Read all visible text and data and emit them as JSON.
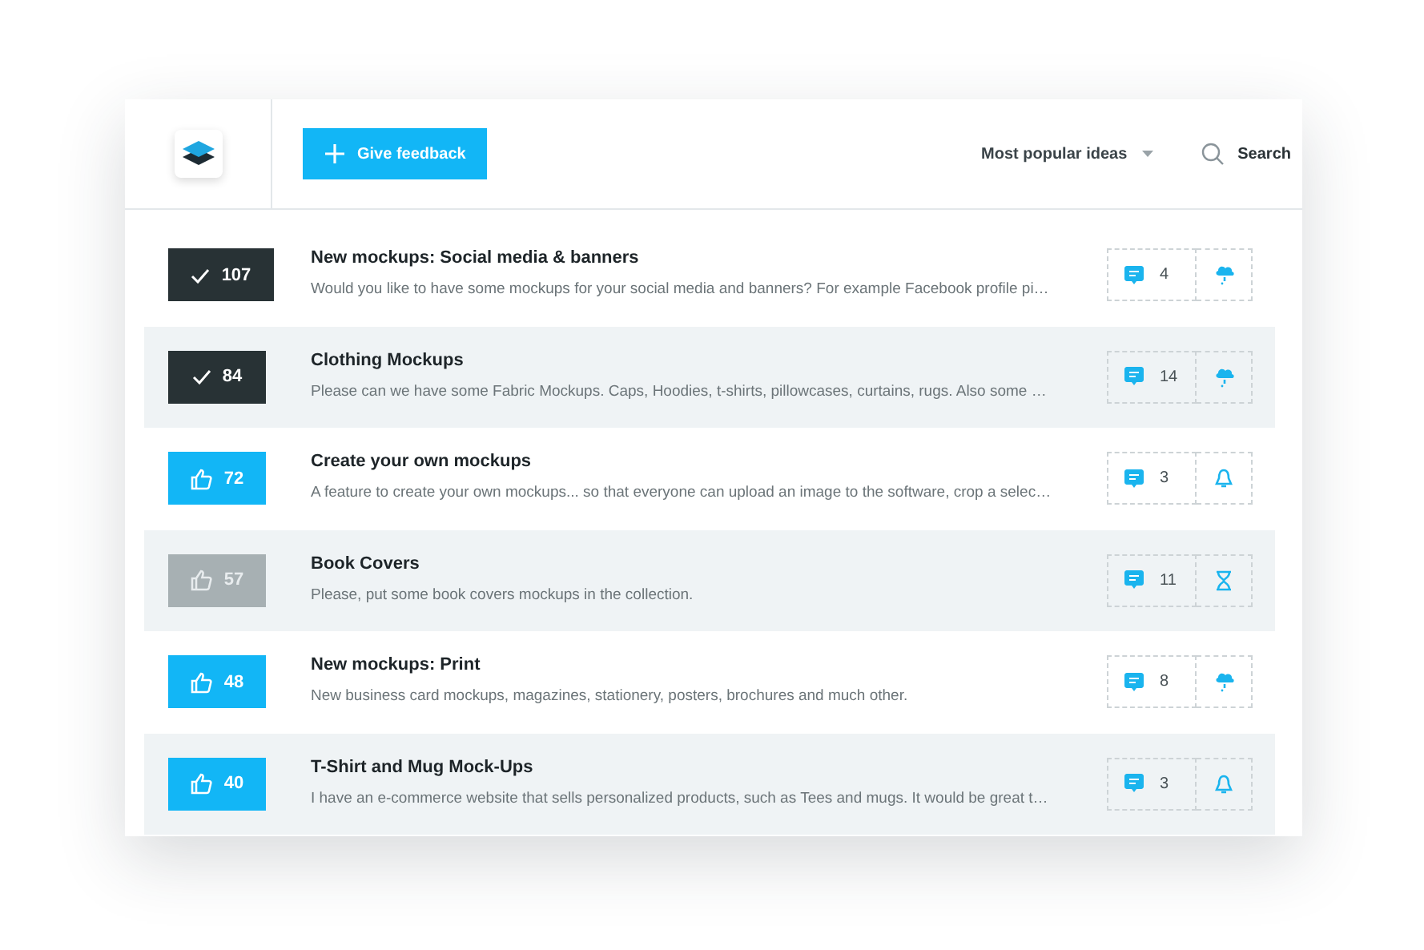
{
  "header": {
    "feedback_button": "Give feedback",
    "sort": {
      "label": "Most popular ideas"
    },
    "search": {
      "label": "Search"
    }
  },
  "ideas": [
    {
      "vote": {
        "count": "107",
        "kind": "completed"
      },
      "title": "New mockups: Social media & banners",
      "description": "Would you like to have some mockups for your social media and banners? For example Facebook profile pi…",
      "comments": "4",
      "status": {
        "kind": "cloud"
      }
    },
    {
      "vote": {
        "count": "84",
        "kind": "completed"
      },
      "title": "Clothing Mockups",
      "description": "Please can we have some Fabric Mockups. Caps, Hoodies, t-shirts, pillowcases, curtains, rugs. Also some …",
      "comments": "14",
      "status": {
        "kind": "cloud"
      }
    },
    {
      "vote": {
        "count": "72",
        "kind": "open"
      },
      "title": "Create your own mockups",
      "description": "A feature to create your own mockups... so that everyone can upload an image to the software, crop a selec…",
      "comments": "3",
      "status": {
        "kind": "bell"
      }
    },
    {
      "vote": {
        "count": "57",
        "kind": "closed"
      },
      "title": "Book Covers",
      "description": "Please, put some book covers mockups in the collection.",
      "comments": "11",
      "status": {
        "kind": "hourglass"
      }
    },
    {
      "vote": {
        "count": "48",
        "kind": "open"
      },
      "title": "New mockups: Print",
      "description": "New business card mockups, magazines, stationery, posters, brochures and much other.",
      "comments": "8",
      "status": {
        "kind": "cloud"
      }
    },
    {
      "vote": {
        "count": "40",
        "kind": "open"
      },
      "title": "T-Shirt and Mug Mock-Ups",
      "description": "I have an e-commerce website that sells personalized products, such as Tees and mugs. It would be great t…",
      "comments": "3",
      "status": {
        "kind": "bell"
      }
    }
  ]
}
